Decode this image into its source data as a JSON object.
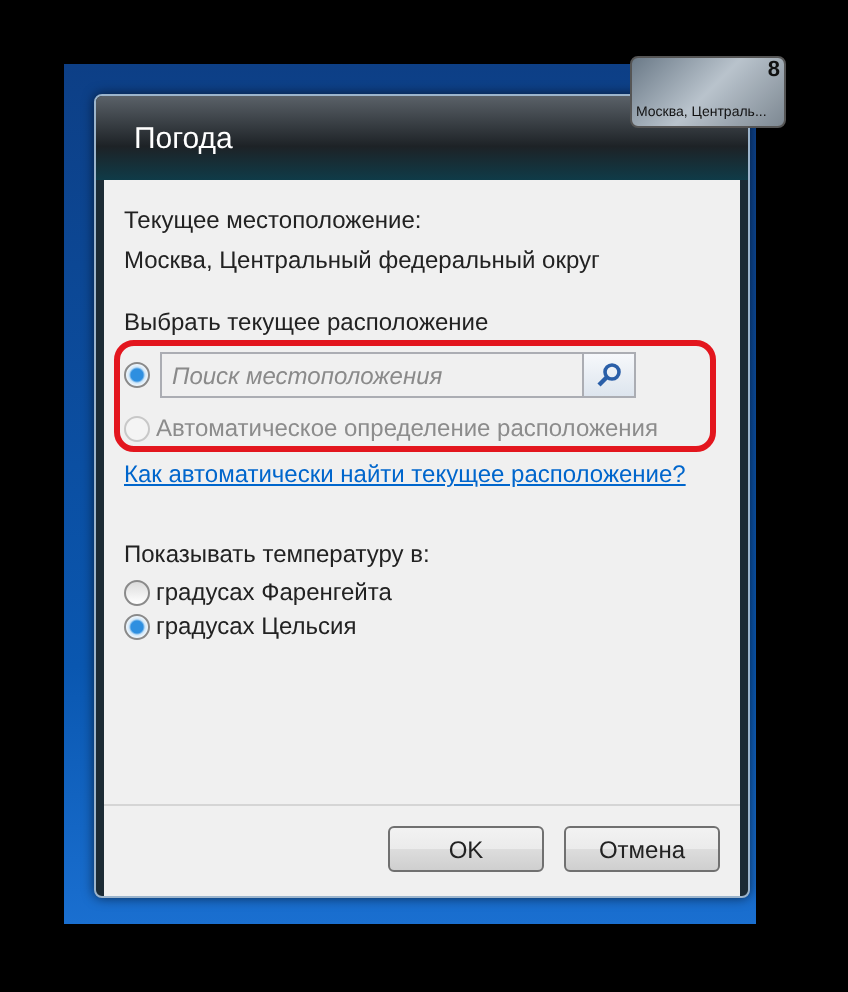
{
  "gadget": {
    "location": "Москва, Централь...",
    "temperature": "8"
  },
  "window": {
    "title": "Погода"
  },
  "current_location": {
    "label": "Текущее местоположение:",
    "value": "Москва, Центральный федеральный округ"
  },
  "location_choice": {
    "label": "Выбрать текущее расположение",
    "highlighted": true,
    "options": [
      {
        "kind": "search",
        "placeholder": "Поиск местоположения",
        "selected": true
      },
      {
        "kind": "auto",
        "label": "Автоматическое определение расположения",
        "selected": false,
        "disabled": true
      }
    ]
  },
  "help_link": "Как автоматически найти текущее расположение?",
  "temperature_units": {
    "label": "Показывать температуру в:",
    "options": [
      {
        "label": "градусах Фаренгейта",
        "selected": false
      },
      {
        "label": "градусах Цельсия",
        "selected": true
      }
    ]
  },
  "buttons": [
    {
      "label": "OK"
    },
    {
      "label": "Отмена"
    }
  ]
}
